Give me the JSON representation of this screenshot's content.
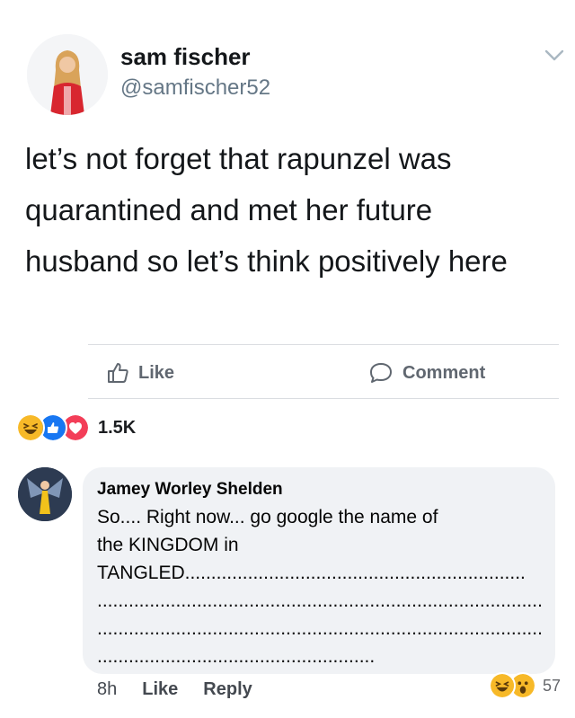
{
  "tweet": {
    "name": "sam fischer",
    "handle": "@samfischer52",
    "lines": [
      "let’s not forget that rapunzel was",
      "quarantined and met her future",
      "husband so let’s think positively here"
    ]
  },
  "actions": {
    "like_label": "Like",
    "comment_label": "Comment"
  },
  "reactions": {
    "icons": [
      "haha-icon",
      "like-icon",
      "love-icon"
    ],
    "count": "1.5K"
  },
  "comment": {
    "author": "Jamey Worley Shelden",
    "lines": [
      "So.... Right now... go google the name of",
      "the KINGDOM in",
      "TANGLED.................................................................",
      "......................................................................................",
      "......................................................................................",
      "....................................................."
    ],
    "time": "8h",
    "like_label": "Like",
    "reply_label": "Reply",
    "reactions": {
      "icons": [
        "haha-icon",
        "wow-icon"
      ],
      "count": "57"
    }
  },
  "colors": {
    "like_blue": "#1877f2",
    "love_red": "#f33e58",
    "emoji_yellow": "#f7b928"
  }
}
